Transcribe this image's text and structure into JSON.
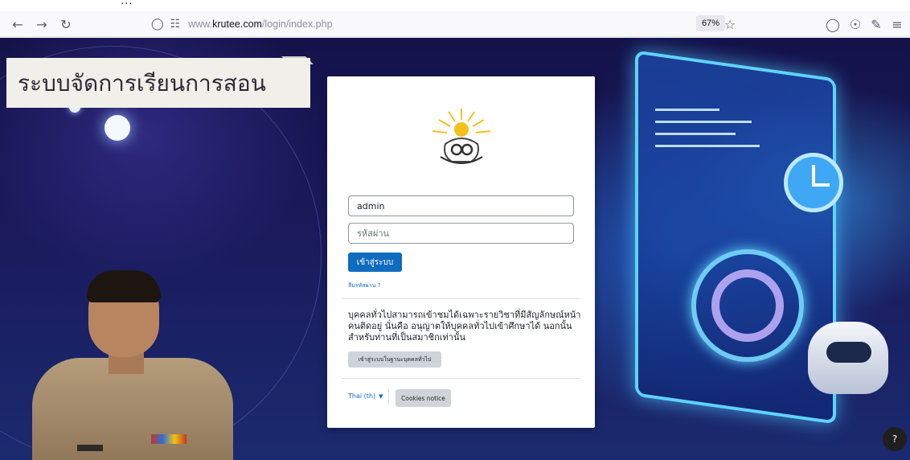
{
  "top_strip": {
    "text": "..."
  },
  "browser": {
    "url_prefix": "www.",
    "url_domain": "krutee.com",
    "url_path": "/login/index.php",
    "zoom": "67%",
    "icons": [
      "back-icon",
      "forward-icon",
      "reload-icon",
      "shield-icon",
      "lock-slash-icon",
      "star-icon",
      "pocket-icon",
      "account-icon",
      "extensions-icon",
      "menu-icon"
    ]
  },
  "banner": {
    "title": "ระบบจัดการเรียนการสอน"
  },
  "login": {
    "username_value": "admin",
    "password_placeholder": "รหัสผ่าน",
    "login_button": "เข้าสู่ระบบ",
    "forgot_link": "ลืมรหัสผ่าน ?",
    "guest_text": "บุคคลทั่วไปสามารถเข้าชมได้เฉพาะรายวิชาที่มีสัญลักษณ์หน้าคนติดอยู่ นั่นคือ อนุญาตให้บุคคลทั่วไปเข้าศึกษาได้ นอกนั้น สำหรับท่านที่เป็นสมาชิกเท่านั้น",
    "guest_button": "เข้าสู่ระบบในฐานะบุคคลทั่วไป",
    "language": "Thai (th)",
    "cookies_button": "Cookies notice"
  },
  "help": {
    "label": "?"
  },
  "colors": {
    "primary": "#0f6cbf",
    "banner_bg": "#f1efe9",
    "page_bg": "#1a1a5c",
    "screen_glow": "#5fd3ff"
  }
}
